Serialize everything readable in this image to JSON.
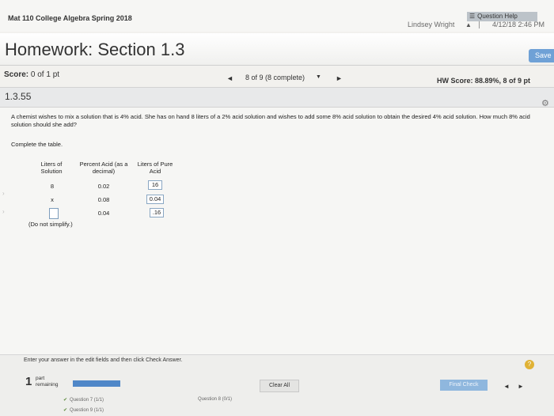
{
  "top": {
    "course": "Mat 110 College Algebra Spring 2018",
    "user": "Lindsey Wright",
    "datetime": "4/12/18 2:46 PM"
  },
  "header": {
    "title": "Homework: Section 1.3",
    "save_label": "Save"
  },
  "score": {
    "label": "Score:",
    "value": "0 of 1 pt"
  },
  "nav": {
    "prev": "◄",
    "label": "8 of 9 (8 complete)",
    "caret": "▼",
    "next": "►",
    "hw_score": "HW Score: 88.89%, 8 of 9 pt"
  },
  "question": {
    "number": "1.3.55",
    "help_label": "Question Help",
    "problem": "A chemist wishes to mix a solution that is 4% acid. She has on hand 8 liters of a 2% acid solution and wishes to add some 8% acid solution to obtain the desired 4% acid solution. How much 8% acid solution should she add?",
    "instruction": "Complete the table.",
    "table": {
      "headers": [
        "Liters of Solution",
        "Percent Acid (as a decimal)",
        "Liters of Pure Acid"
      ],
      "rows": [
        {
          "liters": "8",
          "percent": "0.02",
          "pure": "16"
        },
        {
          "liters": "x",
          "percent": "0.08",
          "pure": "0.04"
        },
        {
          "liters": "",
          "percent": "0.04",
          "pure": ".16"
        }
      ]
    },
    "note": "(Do not simplify.)"
  },
  "footer": {
    "instruction": "Enter your answer in the edit fields and then click Check Answer.",
    "help": "?",
    "parts_count": "1",
    "parts_label_1": "part",
    "parts_label_2": "remaining",
    "progress": 1.0,
    "clear_label": "Clear All",
    "final_label": "Final Check",
    "prev": "◄",
    "next": "►",
    "q7": "Question 7 (1/1)",
    "q8": "Question 8 (0/1)",
    "q9": "Question 9 (1/1)"
  },
  "colors": {
    "accent": "#4f87c8",
    "help_badge": "#e0b235"
  }
}
